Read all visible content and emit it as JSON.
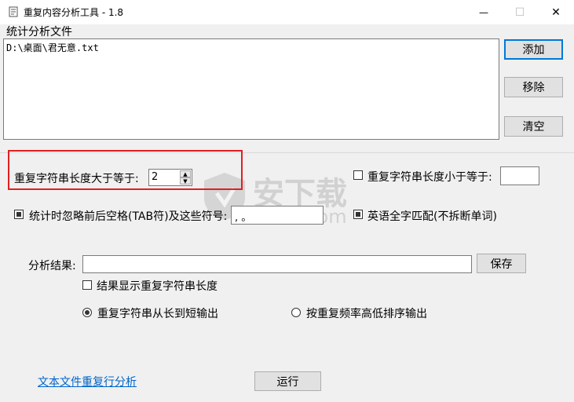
{
  "window": {
    "title": "重复内容分析工具 - 1.8",
    "minimize_glyph": "—",
    "maximize_glyph": "☐",
    "close_glyph": "✕"
  },
  "files": {
    "section_label": "统计分析文件",
    "list": [
      "D:\\桌面\\君无意.txt"
    ],
    "add_label": "添加",
    "remove_label": "移除",
    "clear_label": "清空"
  },
  "options": {
    "min_length_label": "重复字符串长度大于等于:",
    "min_length_value": "2",
    "max_length_label": "重复字符串长度小于等于:",
    "max_length_value": "",
    "ignore_spaces_label": "统计时忽略前后空格(TAB符)及这些符号:",
    "ignore_symbols_value": ", 。",
    "english_word_label": "英语全字匹配(不拆断单词)"
  },
  "result": {
    "label": "分析结果:",
    "path_value": "",
    "save_label": "保存",
    "show_length_label": "结果显示重复字符串长度",
    "sort_by_length_label": "重复字符串从长到短输出",
    "sort_by_frequency_label": "按重复频率高低排序输出"
  },
  "footer": {
    "line_analysis_link": "文本文件重复行分析",
    "run_label": "运行"
  },
  "watermark": {
    "text_cn": "安下载",
    "text_en": "anxz.com"
  },
  "colors": {
    "highlight_border": "#e02020",
    "link": "#0066cc",
    "focus_border": "#0078d7"
  }
}
